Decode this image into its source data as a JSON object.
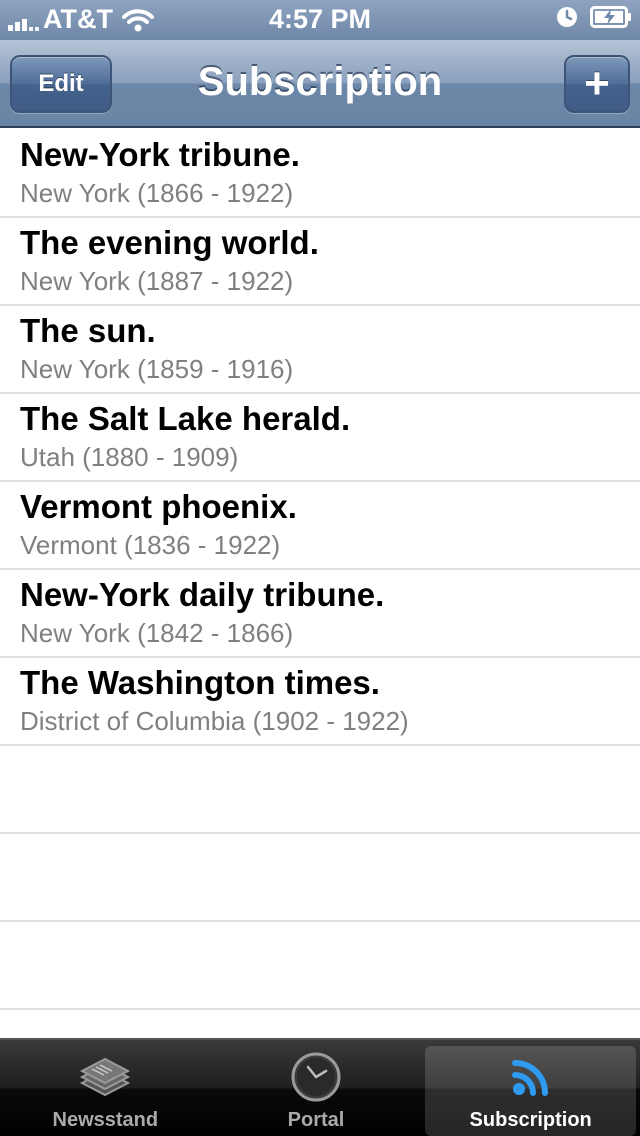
{
  "status_bar": {
    "carrier": "AT&T",
    "time": "4:57 PM"
  },
  "nav": {
    "title": "Subscription",
    "edit_label": "Edit",
    "add_label": "+"
  },
  "list": {
    "items": [
      {
        "title": "New-York tribune.",
        "subtitle": "New York (1866 - 1922)"
      },
      {
        "title": "The evening world.",
        "subtitle": "New York (1887 - 1922)"
      },
      {
        "title": "The sun.",
        "subtitle": "New York (1859 - 1916)"
      },
      {
        "title": "The Salt Lake herald.",
        "subtitle": "Utah (1880 - 1909)"
      },
      {
        "title": "Vermont phoenix.",
        "subtitle": "Vermont (1836 - 1922)"
      },
      {
        "title": "New-York daily tribune.",
        "subtitle": "New York (1842 - 1866)"
      },
      {
        "title": "The Washington times.",
        "subtitle": "District of Columbia (1902 - 1922)"
      }
    ]
  },
  "tab_bar": {
    "tabs": [
      {
        "label": "Newsstand",
        "icon": "newspaper-stack-icon"
      },
      {
        "label": "Portal",
        "icon": "clock-icon"
      },
      {
        "label": "Subscription",
        "icon": "rss-feed-icon"
      }
    ],
    "selected": "Subscription"
  },
  "colors": {
    "nav_bar": "#7f96b5",
    "accent_blue": "#2f9bf0",
    "subtitle_gray": "#808080"
  }
}
